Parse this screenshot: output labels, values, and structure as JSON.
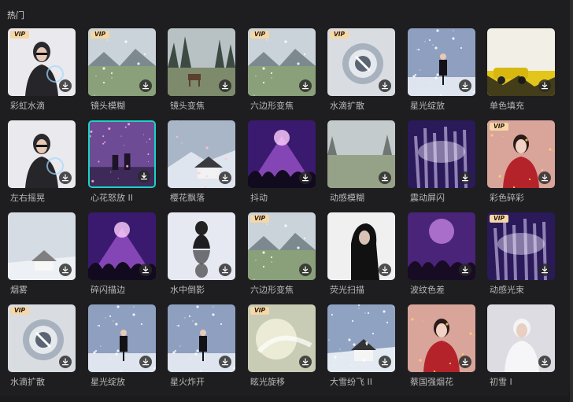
{
  "section": {
    "title": "热门"
  },
  "effects": [
    {
      "label": "彩虹水滴",
      "vip": "VIP",
      "theme": "portrait-light"
    },
    {
      "label": "镜头模糊",
      "vip": "VIP",
      "theme": "meadow"
    },
    {
      "label": "镜头变焦",
      "vip": "",
      "theme": "deer"
    },
    {
      "label": "六边形变焦",
      "vip": "VIP",
      "theme": "meadow"
    },
    {
      "label": "水滴扩散",
      "vip": "VIP",
      "theme": "bubble"
    },
    {
      "label": "星光绽放",
      "vip": "",
      "theme": "snow-sit"
    },
    {
      "label": "单色填充",
      "vip": "",
      "theme": "yellow"
    },
    {
      "label": "左右摇晃",
      "vip": "",
      "theme": "portrait-light"
    },
    {
      "label": "心花怒放 II",
      "vip": "",
      "theme": "purple-couple",
      "selected": true
    },
    {
      "label": "樱花飘落",
      "vip": "",
      "theme": "cabin"
    },
    {
      "label": "抖动",
      "vip": "",
      "theme": "concert"
    },
    {
      "label": "动感模糊",
      "vip": "",
      "theme": "fog-field"
    },
    {
      "label": "震动屏闪",
      "vip": "",
      "theme": "rays"
    },
    {
      "label": "彩色碎彩",
      "vip": "VIP",
      "theme": "red-woman"
    },
    {
      "label": "烟雾",
      "vip": "",
      "theme": "cabin-fog"
    },
    {
      "label": "碎闪描边",
      "vip": "",
      "theme": "concert"
    },
    {
      "label": "水中倒影",
      "vip": "",
      "theme": "reflection"
    },
    {
      "label": "六边形变焦",
      "vip": "VIP",
      "theme": "meadow"
    },
    {
      "label": "荧光扫描",
      "vip": "",
      "theme": "dark-portrait"
    },
    {
      "label": "波纹色差",
      "vip": "",
      "theme": "concert-purple"
    },
    {
      "label": "动感光束",
      "vip": "VIP",
      "theme": "rays"
    },
    {
      "label": "水滴扩散",
      "vip": "VIP",
      "theme": "bubble"
    },
    {
      "label": "星光绽放",
      "vip": "",
      "theme": "snow-sit"
    },
    {
      "label": "星火炸开",
      "vip": "",
      "theme": "snow-sit"
    },
    {
      "label": "眩光旋移",
      "vip": "VIP",
      "theme": "glare"
    },
    {
      "label": "大雪纷飞 II",
      "vip": "",
      "theme": "cabin-snow"
    },
    {
      "label": "蔡国强烟花",
      "vip": "",
      "theme": "red-woman"
    },
    {
      "label": "初雪 I",
      "vip": "",
      "theme": "white-portrait"
    }
  ],
  "download_icon": "download-icon"
}
